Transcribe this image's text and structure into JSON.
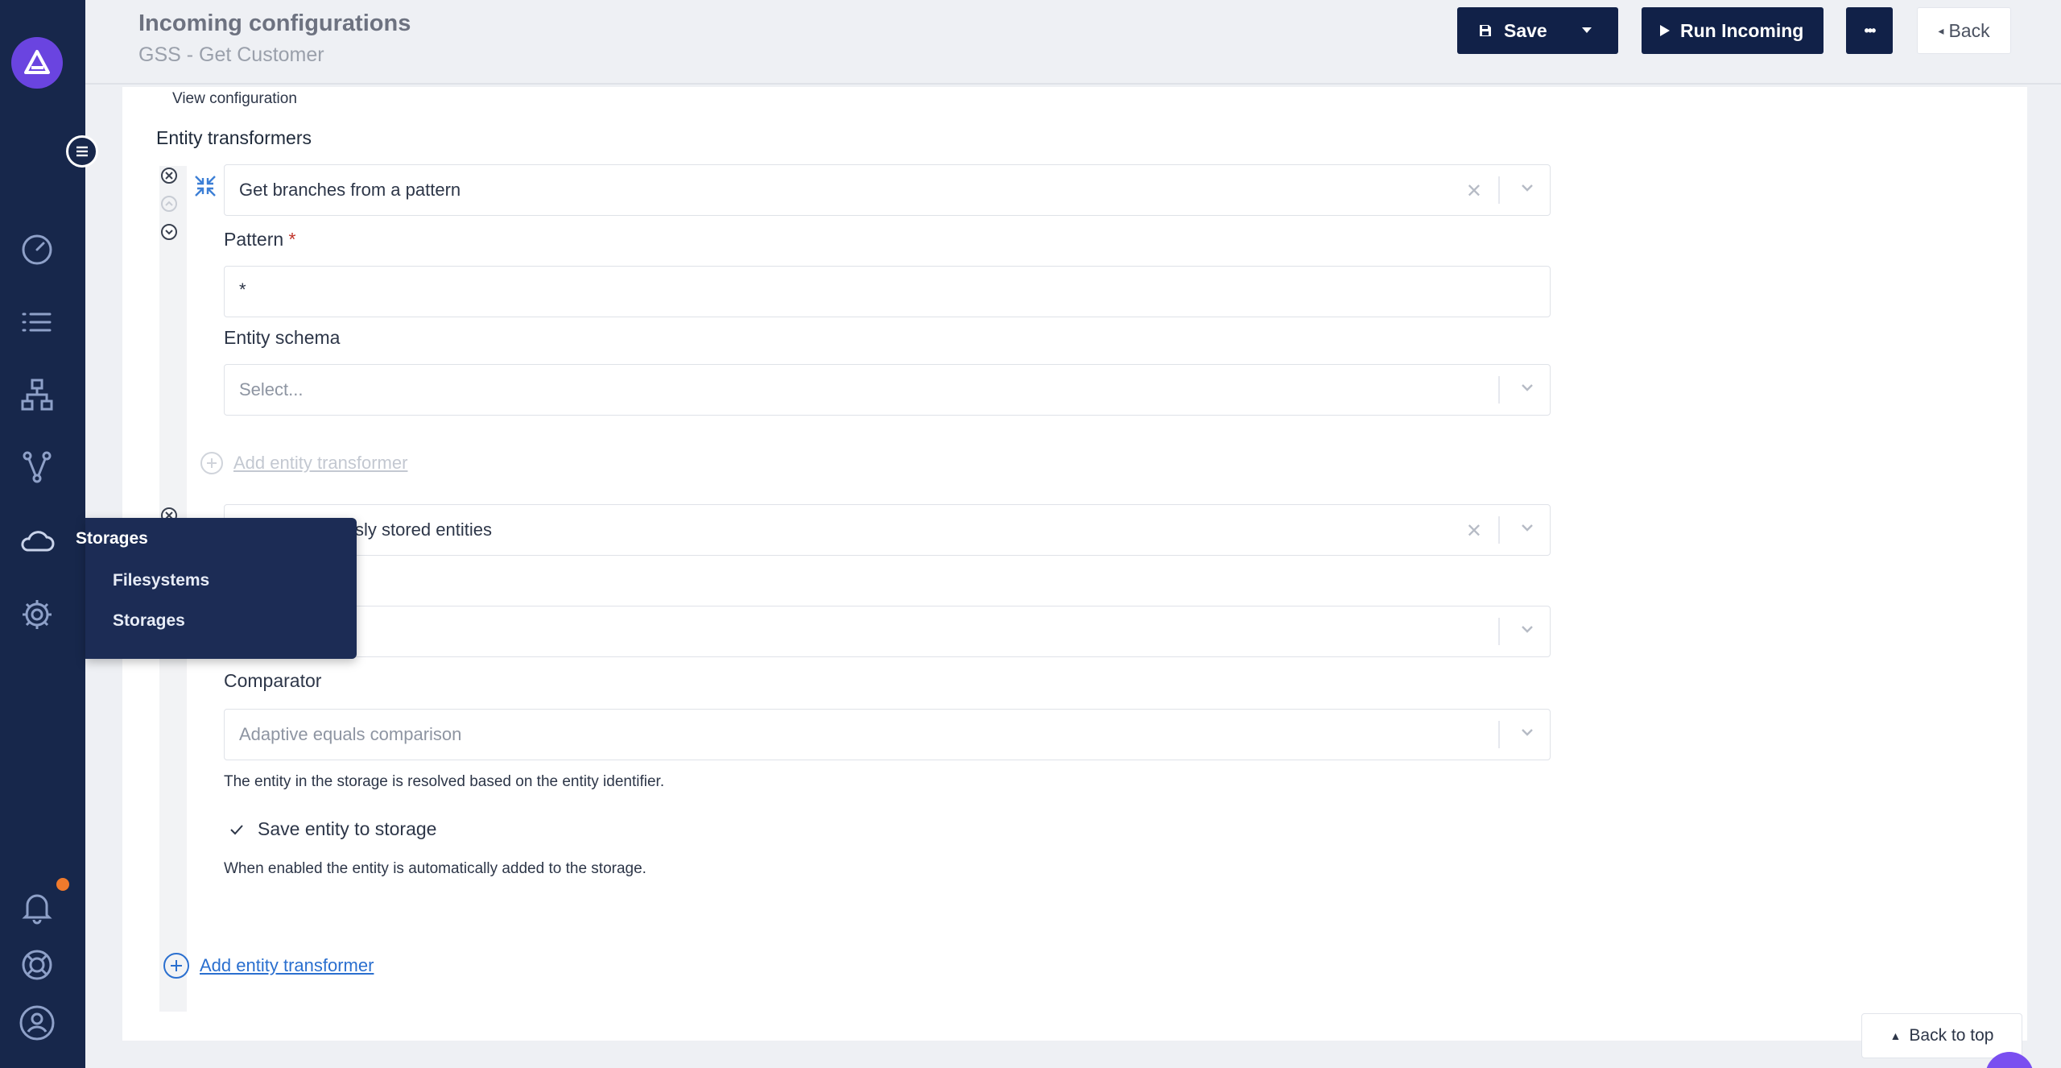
{
  "header": {
    "title": "Incoming configurations",
    "subtitle": "GSS - Get Customer",
    "save_label": "Save",
    "run_label": "Run Incoming",
    "more_label": "•••",
    "back_label": "Back"
  },
  "flyout": {
    "title": "Storages",
    "items": [
      "Filesystems",
      "Storages"
    ]
  },
  "main": {
    "view_configuration": "View configuration",
    "section_title": "Entity transformers",
    "transformer1": {
      "type": "Get branches from a pattern",
      "pattern_label": "Pattern",
      "required_mark": "*",
      "pattern_value": "*",
      "schema_label": "Entity schema",
      "schema_placeholder": "Select...",
      "add_nested": "Add entity transformer"
    },
    "transformer2": {
      "type_visible": "sly stored entities",
      "comparator_label": "Comparator",
      "comparator_value": "Adaptive equals comparison",
      "comparator_help": "The entity in the storage is resolved based on the entity identifier.",
      "save_checkbox_label": "Save entity to storage",
      "save_checkbox_checked": true,
      "save_help": "When enabled the entity is automatically added to the storage."
    },
    "add_transformer": "Add entity transformer",
    "back_to_top": "Back to top"
  },
  "colors": {
    "sidebar": "#17274b",
    "accent_purple": "#6a44e0",
    "button_dark": "#112148",
    "link_blue": "#2a6fcf",
    "notification": "#f07a2c"
  }
}
